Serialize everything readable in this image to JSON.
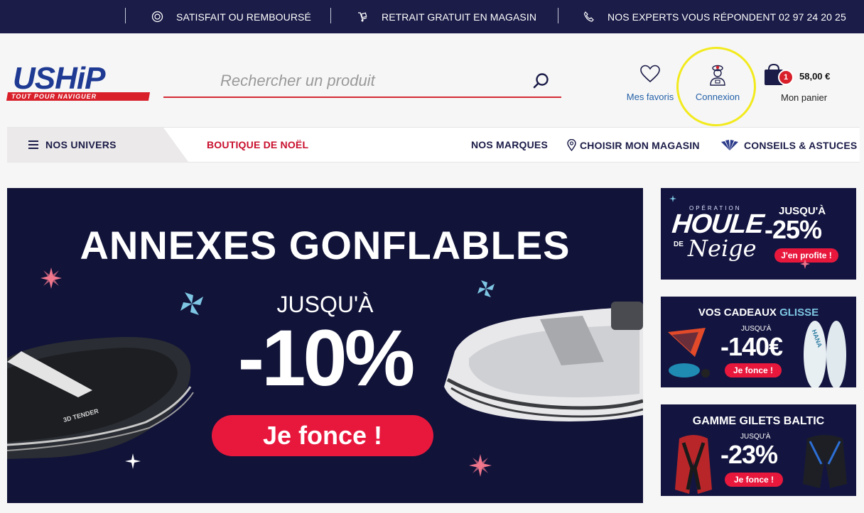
{
  "topbar": {
    "item1": "SATISFAIT OU REMBOURSÉ",
    "item2": "RETRAIT GRATUIT EN MAGASIN",
    "item3": "NOS EXPERTS VOUS RÉPONDENT 02 97 24 20 25"
  },
  "logo": {
    "word": "USHiP",
    "tagline": "TOUT POUR NAVIGUER"
  },
  "search": {
    "placeholder": "Rechercher un produit"
  },
  "header": {
    "favorites": "Mes favoris",
    "login": "Connexion",
    "cart_count": "1",
    "cart_total": "58,00 €",
    "cart_label": "Mon panier"
  },
  "nav": {
    "univers": "NOS UNIVERS",
    "noel": "BOUTIQUE DE NOËL",
    "brands": "NOS MARQUES",
    "store": "CHOISIR MON MAGASIN",
    "tips": "CONSEILS & ASTUCES"
  },
  "hero": {
    "headline": "ANNEXES GONFLABLES",
    "sub": "JUSQU'À",
    "discount": "-10%",
    "cta": "Je fonce !",
    "boat_brand": "3D TENDER"
  },
  "promos": [
    {
      "tag": "OPÉRATION",
      "title1": "HOULE",
      "title2": "DE",
      "title3": "Neige",
      "upto": "JUSQU'À",
      "value": "-25%",
      "cta": "J'en profite !"
    },
    {
      "title": "VOS CADEAUX",
      "title_accent": "GLISSE",
      "upto": "JUSQU'À",
      "value": "-140€",
      "cta": "Je fonce !",
      "board_brand": "HANA"
    },
    {
      "title": "GAMME GILETS BALTIC",
      "upto": "JUSQU'À",
      "value": "-23%",
      "cta": "Je fonce !"
    }
  ],
  "colors": {
    "navy": "#1b1c48",
    "red": "#d81f2a",
    "promo_red": "#e8183d",
    "link_blue": "#2561a8",
    "highlight": "#f2ea1d"
  }
}
